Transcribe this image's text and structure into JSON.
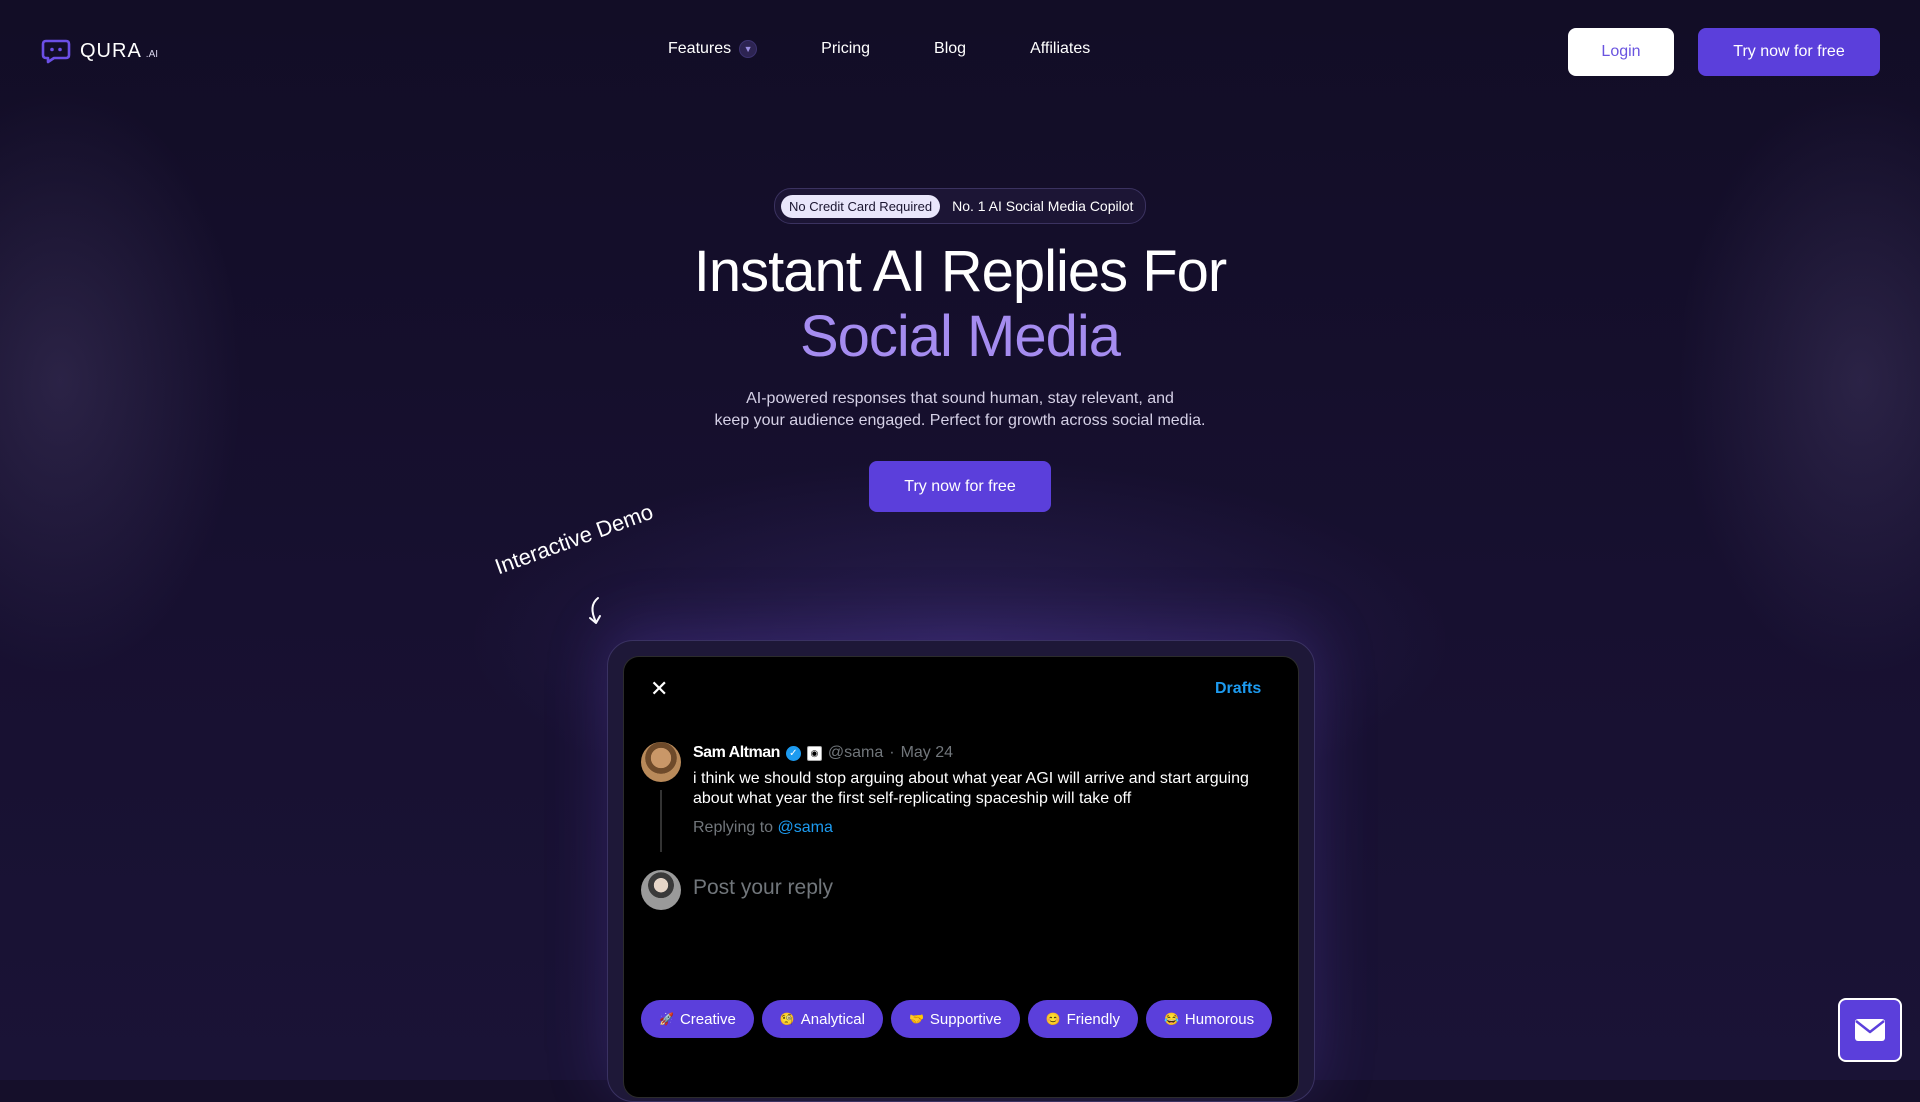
{
  "nav": {
    "logo_text": "QURA",
    "logo_sub": ".AI",
    "links": [
      {
        "label": "Features",
        "has_dropdown": true
      },
      {
        "label": "Pricing"
      },
      {
        "label": "Blog"
      },
      {
        "label": "Affiliates"
      }
    ],
    "login_label": "Login",
    "try_label": "Try now for free"
  },
  "hero": {
    "pill_tag": "No Credit Card Required",
    "pill_text": "No. 1 AI Social Media Copilot",
    "title_line1": "Instant AI Replies For",
    "title_line2": "Social Media",
    "subtitle_line1": "AI-powered responses that sound human, stay relevant, and",
    "subtitle_line2": "keep your audience engaged. Perfect for growth across social media.",
    "cta_label": "Try now for free"
  },
  "demo": {
    "label": "Interactive Demo",
    "close_icon": "close-icon",
    "drafts_label": "Drafts",
    "tweet": {
      "name": "Sam Altman",
      "handle": "@sama",
      "sep": "·",
      "date": "May 24",
      "text": "i think we should stop arguing about what year AGI will arrive and start arguing about what year the first self-replicating spaceship will take off",
      "replying_prefix": "Replying to",
      "replying_handle": "@sama"
    },
    "reply_placeholder": "Post your reply",
    "tones": [
      {
        "icon": "🚀",
        "label": "Creative"
      },
      {
        "icon": "🧐",
        "label": "Analytical"
      },
      {
        "icon": "🤝",
        "label": "Supportive"
      },
      {
        "icon": "😊",
        "label": "Friendly"
      },
      {
        "icon": "😂",
        "label": "Humorous"
      }
    ]
  },
  "colors": {
    "accent": "#5b3fdb",
    "highlight": "#a58cf0",
    "link": "#1d9bf0",
    "background": "#150f2a"
  },
  "chat_widget": {
    "icon": "mail-icon"
  }
}
